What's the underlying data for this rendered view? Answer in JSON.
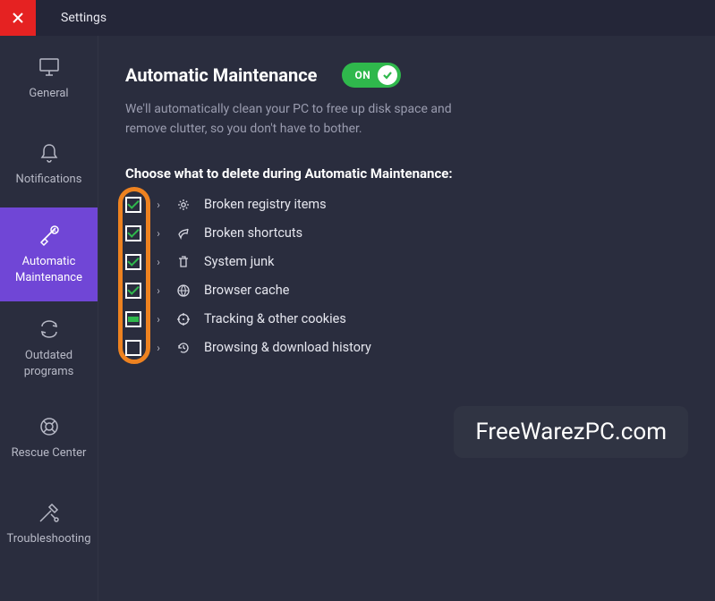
{
  "titlebar": {
    "title": "Settings",
    "close_tooltip": "Close"
  },
  "sidebar": {
    "items": [
      {
        "label": "General",
        "icon": "monitor-icon"
      },
      {
        "label": "Notifications",
        "icon": "bell-icon"
      },
      {
        "label": "Automatic\nMaintenance",
        "icon": "broom-icon"
      },
      {
        "label": "Outdated programs",
        "icon": "refresh-icon"
      },
      {
        "label": "Rescue Center",
        "icon": "lifebuoy-icon"
      },
      {
        "label": "Troubleshooting",
        "icon": "tools-icon"
      }
    ],
    "active_index": 2
  },
  "main": {
    "heading": "Automatic Maintenance",
    "toggle_label": "ON",
    "toggle_state": true,
    "description": "We'll automatically clean your PC to free up disk space and remove clutter, so you don't have to bother.",
    "section_title": "Choose what to delete during Automatic Maintenance:",
    "options": [
      {
        "state": "checked",
        "icon": "registry-icon",
        "label": "Broken registry items"
      },
      {
        "state": "checked",
        "icon": "shortcut-icon",
        "label": "Broken shortcuts"
      },
      {
        "state": "checked",
        "icon": "trash-icon",
        "label": "System junk"
      },
      {
        "state": "checked",
        "icon": "globe-icon",
        "label": "Browser cache"
      },
      {
        "state": "partial",
        "icon": "target-icon",
        "label": "Tracking & other cookies"
      },
      {
        "state": "unchecked",
        "icon": "history-icon",
        "label": "Browsing & download history"
      }
    ]
  },
  "watermark": "FreeWarezPC.com",
  "colors": {
    "accent": "#7046d6",
    "toggle_on": "#2fb84c",
    "highlight": "#ee8220",
    "close": "#e52222"
  }
}
